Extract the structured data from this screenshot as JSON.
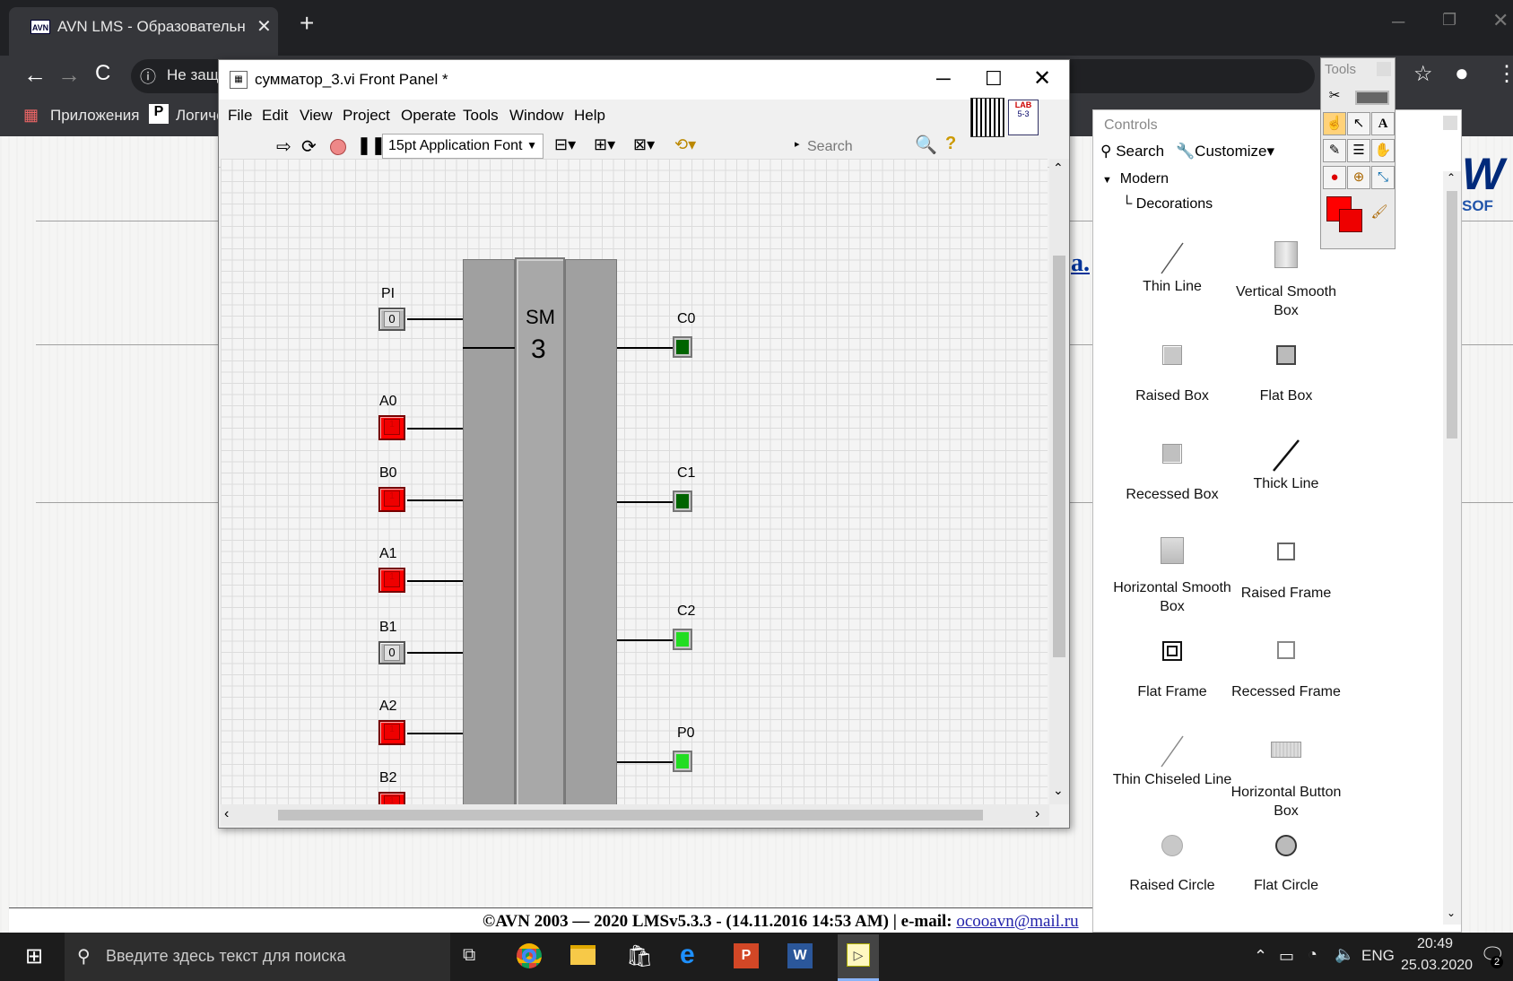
{
  "browser": {
    "tab_title": "AVN LMS - Образовательный п",
    "tab_icon": "AVN",
    "new_tab": "+",
    "address": "Не защ",
    "bookmarks": [
      "Приложения",
      "Логиче"
    ]
  },
  "page": {
    "heading_fragment": "a.",
    "logo_text": "SOF",
    "footer_text": "©AVN 2003 — 2020 LMSv5.3.3 - (14.11.2016 14:53 AM) | e-mail: ",
    "footer_email": "ocooavn@mail.ru"
  },
  "labview": {
    "title": "сумматор_3.vi Front Panel *",
    "menu": [
      "File",
      "Edit",
      "View",
      "Project",
      "Operate",
      "Tools",
      "Window",
      "Help"
    ],
    "font_select": "15pt Application Font",
    "search_placeholder": "Search",
    "lab_badge": "LAB",
    "lab_badge_sub": "5-3",
    "block": {
      "title": "SM",
      "number": "3"
    },
    "inputs": [
      {
        "label": "PI",
        "state": "off",
        "value": "0"
      },
      {
        "label": "A0",
        "state": "on",
        "value": "1"
      },
      {
        "label": "B0",
        "state": "on",
        "value": "1"
      },
      {
        "label": "A1",
        "state": "on",
        "value": "1"
      },
      {
        "label": "B1",
        "state": "off",
        "value": "0"
      },
      {
        "label": "A2",
        "state": "on",
        "value": "1"
      },
      {
        "label": "B2",
        "state": "on",
        "value": "1"
      }
    ],
    "outputs": [
      {
        "label": "C0",
        "state": "off"
      },
      {
        "label": "C1",
        "state": "off"
      },
      {
        "label": "C2",
        "state": "on"
      },
      {
        "label": "P0",
        "state": "on"
      }
    ],
    "colors": {
      "on_input": "#ff0000",
      "led_off": "#006400",
      "led_on": "#22dd22"
    }
  },
  "controls_palette": {
    "title": "Controls",
    "search_label": "Search",
    "customize_label": "Customize▾",
    "tree_root": "Modern",
    "tree_child": "Decorations",
    "items": [
      {
        "label": "Thin Line",
        "icon": "thin-line-icon"
      },
      {
        "label": "Vertical Smooth Box",
        "icon": "vertical-smooth-box-icon"
      },
      {
        "label": "Raised Box",
        "icon": "raised-box-icon"
      },
      {
        "label": "Flat Box",
        "icon": "flat-box-icon"
      },
      {
        "label": "Recessed Box",
        "icon": "recessed-box-icon"
      },
      {
        "label": "Thick Line",
        "icon": "thick-line-icon"
      },
      {
        "label": "Horizontal Smooth Box",
        "icon": "horizontal-smooth-box-icon"
      },
      {
        "label": "Raised Frame",
        "icon": "raised-frame-icon"
      },
      {
        "label": "Flat Frame",
        "icon": "flat-frame-icon"
      },
      {
        "label": "Recessed Frame",
        "icon": "recessed-frame-icon"
      },
      {
        "label": "Thin Chiseled Line",
        "icon": "thin-chiseled-line-icon"
      },
      {
        "label": "Horizontal Button Box",
        "icon": "horizontal-button-box-icon"
      },
      {
        "label": "Raised Circle",
        "icon": "raised-circle-icon"
      },
      {
        "label": "Flat Circle",
        "icon": "flat-circle-icon"
      }
    ]
  },
  "tools_palette": {
    "title": "Tools"
  },
  "taskbar": {
    "search_placeholder": "Введите здесь текст для поиска",
    "lang": "ENG",
    "time": "20:49",
    "date": "25.03.2020",
    "notif_count": "2"
  }
}
